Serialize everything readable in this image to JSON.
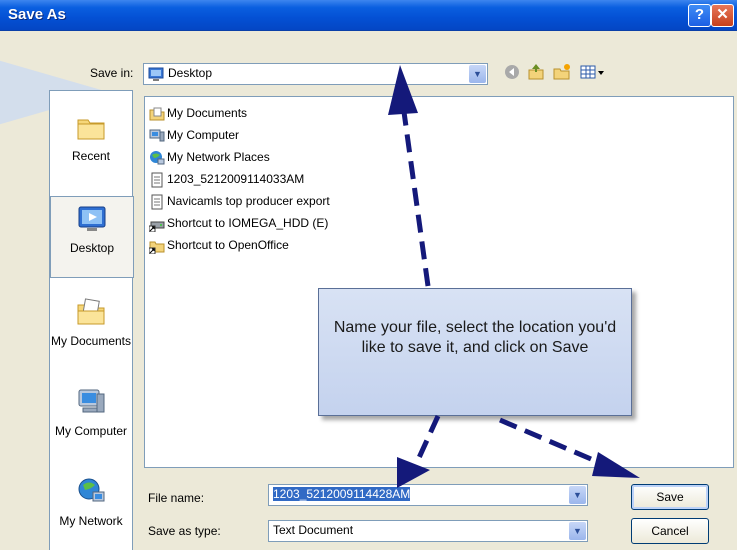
{
  "window": {
    "title": "Save As",
    "help_glyph": "?",
    "close_glyph": "✕"
  },
  "toolbar": {
    "save_in_label": "Save in:",
    "save_in_value": "Desktop",
    "icons": [
      "back-icon",
      "up-folder-icon",
      "new-folder-icon",
      "view-menu-icon"
    ]
  },
  "places": [
    {
      "label": "Recent",
      "icon": "recent-folder-icon"
    },
    {
      "label": "Desktop",
      "icon": "desktop-icon",
      "selected": true
    },
    {
      "label": "My Documents",
      "icon": "my-documents-icon"
    },
    {
      "label": "My Computer",
      "icon": "my-computer-icon"
    },
    {
      "label": "My Network",
      "icon": "my-network-icon"
    }
  ],
  "files": [
    {
      "name": "My Documents",
      "icon": "folder-icon"
    },
    {
      "name": "My Computer",
      "icon": "computer-icon"
    },
    {
      "name": "My Network Places",
      "icon": "network-icon"
    },
    {
      "name": "1203_5212009114033AM",
      "icon": "text-file-icon"
    },
    {
      "name": "Navicamls top producer export",
      "icon": "text-file-icon"
    },
    {
      "name": "Shortcut to IOMEGA_HDD (E)",
      "icon": "drive-shortcut-icon"
    },
    {
      "name": "Shortcut to OpenOffice",
      "icon": "folder-shortcut-icon"
    }
  ],
  "form": {
    "file_name_label": "File name:",
    "file_name_value": "1203_5212009114428AM",
    "save_as_type_label": "Save as type:",
    "save_as_type_value": "Text Document"
  },
  "buttons": {
    "save": "Save",
    "cancel": "Cancel"
  },
  "callout": {
    "text": "Name your file, select the location you'd like to save it, and click on Save"
  },
  "colors": {
    "title_bar": "#0450d4",
    "dialog_bg": "#ece9d8",
    "callout_bg": "#c9d6f0",
    "arrow": "#14197a",
    "selection": "#316ac5"
  }
}
